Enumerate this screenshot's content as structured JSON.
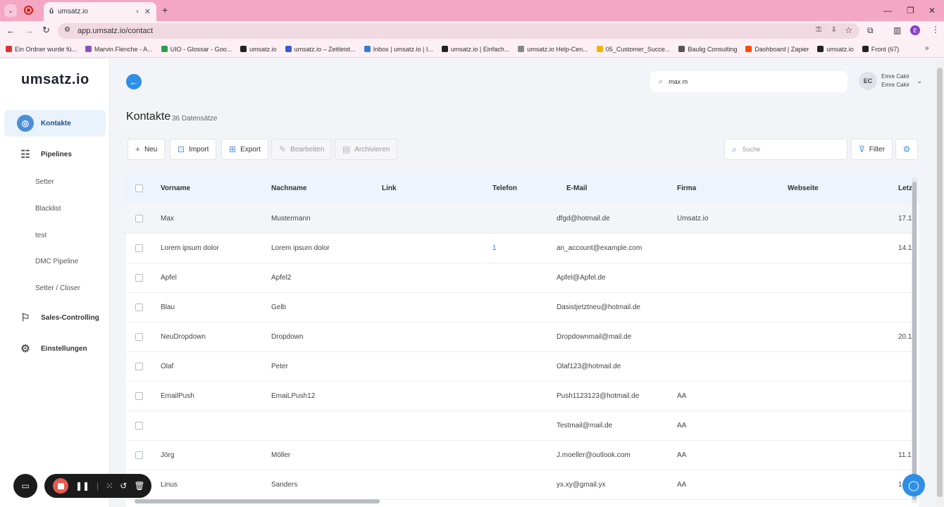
{
  "browser": {
    "tab_title": "umsatz.io",
    "url": "app.umsatz.io/contact",
    "bookmarks": [
      {
        "label": "Ein Ordner wurde fü...",
        "color": "#d33"
      },
      {
        "label": "Marvin Flenche - A...",
        "color": "#8a4fc7"
      },
      {
        "label": "UIO - Glossar - Goo...",
        "color": "#2e9c4a"
      },
      {
        "label": "umsatz.io",
        "color": "#222"
      },
      {
        "label": "umsatz.io – Zeitleist...",
        "color": "#3a5bd1"
      },
      {
        "label": "Inbox | umsatz.io | I...",
        "color": "#3a7bd5"
      },
      {
        "label": "umsatz.io | Einfach...",
        "color": "#222"
      },
      {
        "label": "umsatz.io Help-Cen...",
        "color": "#888"
      },
      {
        "label": "05_Customer_Succe...",
        "color": "#f4b400"
      },
      {
        "label": "Baulig Consulting",
        "color": "#555"
      },
      {
        "label": "Dashboard | Zapier",
        "color": "#ff4a00"
      },
      {
        "label": "umsatz.io",
        "color": "#222"
      },
      {
        "label": "Front (67)",
        "color": "#222"
      }
    ],
    "profile_initial": "E"
  },
  "sidebar": {
    "logo": "umsatz.io",
    "items": [
      {
        "label": "Kontakte",
        "icon": "contacts-icon"
      },
      {
        "label": "Pipelines",
        "icon": "pipelines-icon"
      },
      {
        "label": "Sales-Controlling",
        "icon": "sales-controlling-icon"
      },
      {
        "label": "Einstellungen",
        "icon": "settings-gear-icon"
      }
    ],
    "pipeline_subitems": [
      "Setter",
      "Blacklist",
      "test",
      "DMC Pipeline",
      "Setter / Closer"
    ]
  },
  "header": {
    "search_value": "max m",
    "user_initials": "EC",
    "user_name_1": "Emre Cakir",
    "user_name_2": "Emre Cakir"
  },
  "page": {
    "title": "Kontakte",
    "count": "36 Datensätze"
  },
  "toolbar": {
    "new_label": "Neu",
    "import_label": "Import",
    "export_label": "Export",
    "edit_label": "Bearbeiten",
    "archive_label": "Archivieren",
    "search_placeholder": "Suche",
    "filter_label": "Filter"
  },
  "table": {
    "columns": [
      "Vorname",
      "Nachname",
      "Link",
      "Telefon",
      "E-Mail",
      "Firma",
      "Webseite",
      "Letz"
    ],
    "rows": [
      {
        "vorname": "Max",
        "nachname": "Mustermann",
        "link": "",
        "telefon": "",
        "email": "dfgd@hotmail.de",
        "firma": "Umsatz.io",
        "webseite": "",
        "letzte": "17.1"
      },
      {
        "vorname": "Lorem ipsum dolor",
        "nachname": "Lorem ipsum dolor",
        "link": "",
        "telefon": "1",
        "email": "an_account@example.com",
        "firma": "",
        "webseite": "",
        "letzte": "14.1."
      },
      {
        "vorname": "Apfel",
        "nachname": "Apfel2",
        "link": "",
        "telefon": "",
        "email": "Apfel@Apfel.de",
        "firma": "",
        "webseite": "",
        "letzte": ""
      },
      {
        "vorname": "Blau",
        "nachname": "Gelb",
        "link": "",
        "telefon": "",
        "email": "Dasistjetztneu@hotmail.de",
        "firma": "",
        "webseite": "",
        "letzte": ""
      },
      {
        "vorname": "NeuDropdown",
        "nachname": "Dropdown",
        "link": "",
        "telefon": "",
        "email": "Dropdownmail@mail.de",
        "firma": "",
        "webseite": "",
        "letzte": "20.1"
      },
      {
        "vorname": "Olaf",
        "nachname": "Peter",
        "link": "",
        "telefon": "",
        "email": "Olaf123@hotmail.de",
        "firma": "",
        "webseite": "",
        "letzte": ""
      },
      {
        "vorname": "EmailPush",
        "nachname": "EmaiLPush12",
        "link": "",
        "telefon": "",
        "email": "Push1123123@hotmail.de",
        "firma": "AA",
        "webseite": "",
        "letzte": ""
      },
      {
        "vorname": "",
        "nachname": "",
        "link": "",
        "telefon": "",
        "email": "Testmail@mail.de",
        "firma": "AA",
        "webseite": "",
        "letzte": ""
      },
      {
        "vorname": "Jörg",
        "nachname": "Möller",
        "link": "",
        "telefon": "",
        "email": "J.moeller@outlook.com",
        "firma": "AA",
        "webseite": "",
        "letzte": "11.1("
      },
      {
        "vorname": "Linus",
        "nachname": "Sanders",
        "link": "",
        "telefon": "",
        "email": "yx.xy@gmail.yx",
        "firma": "AA",
        "webseite": "",
        "letzte": "1"
      }
    ]
  }
}
